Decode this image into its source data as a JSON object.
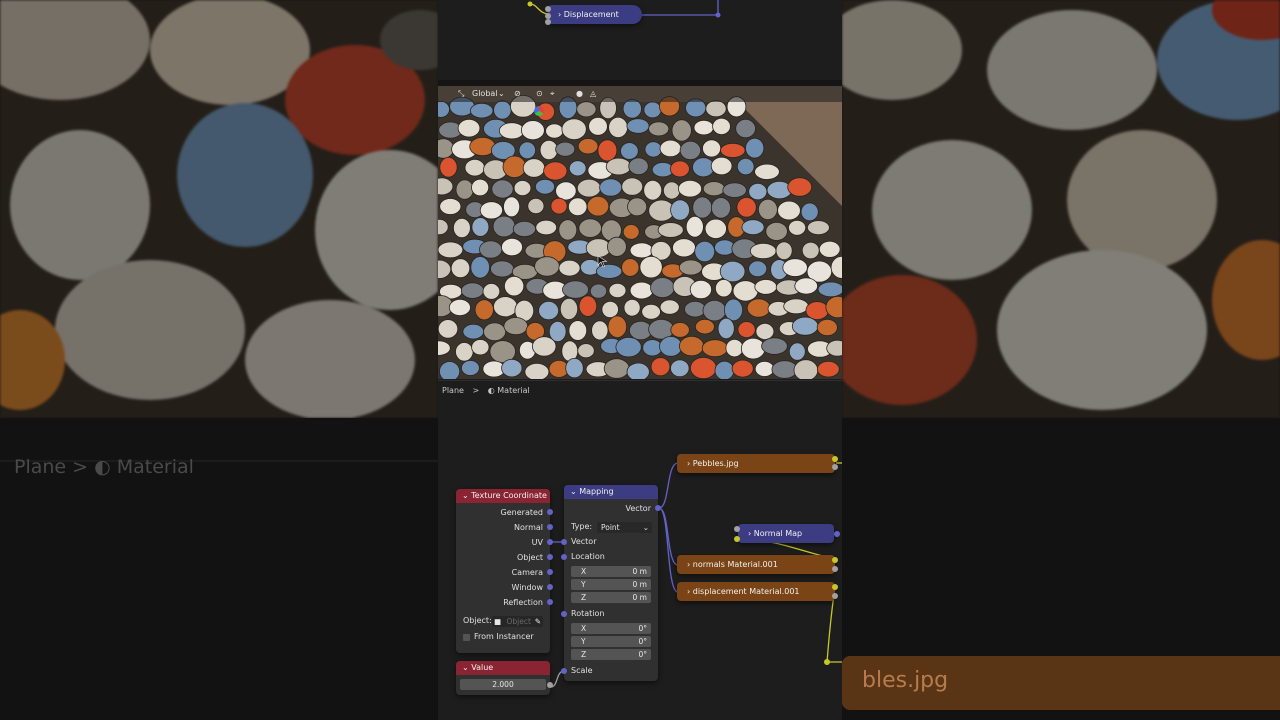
{
  "top_editor": {
    "displacement_node": "Displacement"
  },
  "viewport": {
    "transform_orientation": "Global",
    "cursor_glyph": "⌖"
  },
  "breadcrumb": {
    "object": "Plane",
    "separator": ">",
    "material": "Material"
  },
  "background": {
    "breadcrumb": "Plane  >  ◐  Material",
    "node_label": "bles.jpg"
  },
  "nodes": {
    "texture_coordinate": {
      "title": "Texture Coordinate",
      "outputs": [
        "Generated",
        "Normal",
        "UV",
        "Object",
        "Camera",
        "Window",
        "Reflection"
      ],
      "object_label": "Object:",
      "object_placeholder": "Object",
      "from_instancer": "From Instancer"
    },
    "value": {
      "title": "Value",
      "value": "2.000"
    },
    "mapping": {
      "title": "Mapping",
      "output": "Vector",
      "type_label": "Type:",
      "type_value": "Point",
      "vector_label": "Vector",
      "location_label": "Location",
      "location": [
        {
          "axis": "X",
          "value": "0 m"
        },
        {
          "axis": "Y",
          "value": "0 m"
        },
        {
          "axis": "Z",
          "value": "0 m"
        }
      ],
      "rotation_label": "Rotation",
      "rotation": [
        {
          "axis": "X",
          "value": "0°"
        },
        {
          "axis": "Y",
          "value": "0°"
        },
        {
          "axis": "Z",
          "value": "0°"
        }
      ],
      "scale_label": "Scale"
    },
    "pebbles": {
      "title": "Pebbles.jpg"
    },
    "normal_map": {
      "title": "Normal Map"
    },
    "normals_tex": {
      "title": "normals Material.001"
    },
    "displacement_tex": {
      "title": "displacement Material.001"
    }
  },
  "colors": {
    "input_header": "#8a2332",
    "vector_header": "#3c3c83",
    "texture_node": "#7a4416",
    "socket_vector": "#6363c7",
    "socket_color": "#c7c729",
    "socket_gray": "#a1a1a1"
  }
}
